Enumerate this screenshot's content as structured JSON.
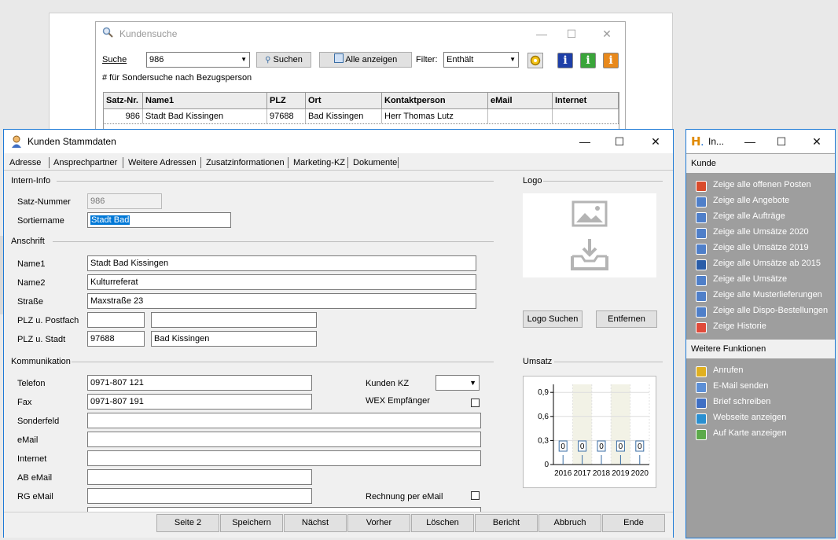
{
  "kundensuche": {
    "title": "Kundensuche",
    "suche_label": "Suche",
    "suche_value": "986",
    "suchen_button": "Suchen",
    "alle_button": "Alle anzeigen",
    "filter_label": "Filter:",
    "filter_value": "Enthält",
    "hint": "# für Sondersuche nach Bezugsperson",
    "columns": [
      "Satz-Nr.",
      "Name1",
      "PLZ",
      "Ort",
      "Kontaktperson",
      "eMail",
      "Internet"
    ],
    "row": [
      "986",
      "Stadt Bad Kissingen",
      "97688",
      "Bad Kissingen",
      "Herr Thomas Lutz",
      "",
      ""
    ]
  },
  "stamm": {
    "title": "Kunden Stammdaten",
    "tabs": [
      "Adresse",
      "Ansprechpartner",
      "Weitere Adressen",
      "Zusatzinformationen",
      "Marketing-KZ",
      "Dokumente"
    ],
    "sections": {
      "intern": "Intern-Info",
      "anschrift": "Anschrift",
      "komm": "Kommunikation",
      "logo": "Logo",
      "umsatz": "Umsatz"
    },
    "fields": {
      "satznr_label": "Satz-Nummer",
      "satznr": "986",
      "sortier_label": "Sortiername",
      "sortier": "Stadt Bad",
      "name1_label": "Name1",
      "name1": "Stadt Bad Kissingen",
      "name2_label": "Name2",
      "name2": "Kulturreferat",
      "strasse_label": "Straße",
      "strasse": "Maxstraße 23",
      "postfach_label": "PLZ u. Postfach",
      "stadt_label": "PLZ u. Stadt",
      "plz": "97688",
      "stadt": "Bad Kissingen",
      "telefon_label": "Telefon",
      "telefon": "0971-807 121",
      "fax_label": "Fax",
      "fax": "0971-807 191",
      "sonder_label": "Sonderfeld",
      "email_label": "eMail",
      "internet_label": "Internet",
      "abemail_label": "AB eMail",
      "rgemail_label": "RG eMail",
      "kundenkz_label": "Kunden KZ",
      "wex_label": "WEX Empfänger",
      "rechnung_label": "Rechnung per eMail"
    },
    "logo_suchen": "Logo Suchen",
    "entfernen": "Entfernen",
    "footer": [
      "Seite 2",
      "Speichern",
      "Nächst",
      "Vorher",
      "Löschen",
      "Bericht",
      "Abbruch",
      "Ende"
    ]
  },
  "chart_data": {
    "type": "bar",
    "categories": [
      "2016",
      "2017",
      "2018",
      "2019",
      "2020"
    ],
    "values": [
      0,
      0,
      0,
      0,
      0
    ],
    "data_labels": [
      "0",
      "0",
      "0",
      "0",
      "0"
    ],
    "y_ticks": [
      "0,9",
      "0,6",
      "0,3",
      "0"
    ],
    "ylim": [
      0,
      1.0
    ]
  },
  "sidebar": {
    "title": "In...",
    "header1": "Kunde",
    "items1": [
      "Zeige alle offenen Posten",
      "Zeige alle Angebote",
      "Zeige alle Aufträge",
      "Zeige alle Umsätze 2020",
      "Zeige alle Umsätze 2019",
      "Zeige alle Umsätze ab 2015",
      "Zeige alle Umsätze",
      "Zeige alle Musterlieferungen",
      "Zeige alle Dispo-Bestellungen",
      "Zeige Historie"
    ],
    "header2": "Weitere Funktionen",
    "items2": [
      "Anrufen",
      "E-Mail senden",
      "Brief schreiben",
      "Webseite anzeigen",
      "Auf Karte anzeigen"
    ]
  }
}
